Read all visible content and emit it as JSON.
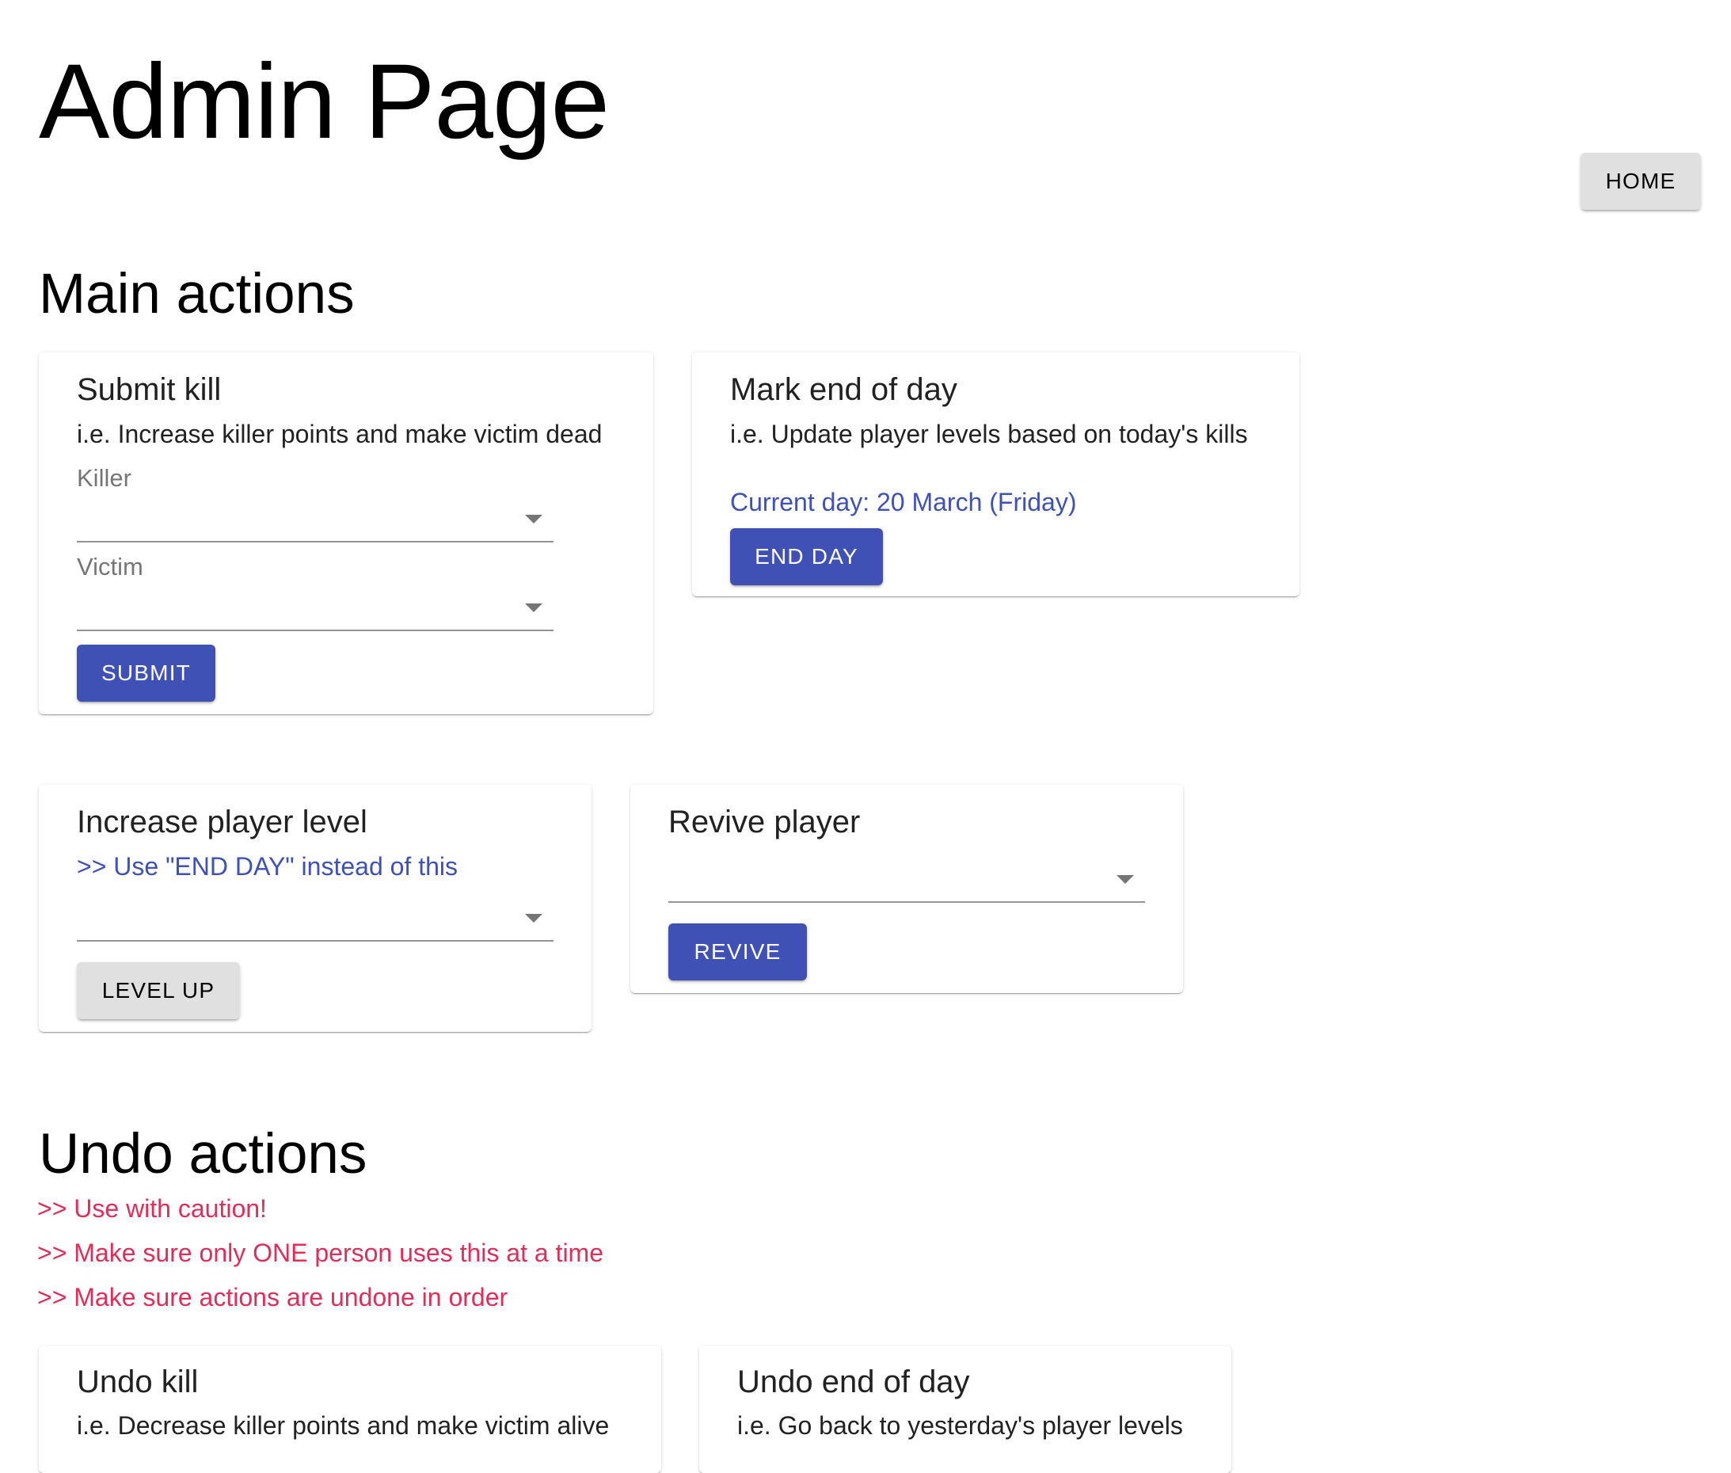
{
  "header": {
    "title": "Admin Page",
    "home_label": "HOME"
  },
  "main_actions": {
    "title": "Main actions",
    "submit_kill": {
      "title": "Submit kill",
      "description": "i.e. Increase killer points and make victim dead",
      "killer_label": "Killer",
      "victim_label": "Victim",
      "submit_label": "SUBMIT"
    },
    "end_of_day": {
      "title": "Mark end of day",
      "description": "i.e. Update player levels based on today's kills",
      "current_day": "Current day: 20 March (Friday)",
      "end_day_label": "END DAY"
    },
    "increase_level": {
      "title": "Increase player level",
      "note": ">> Use \"END DAY\" instead of this",
      "level_up_label": "LEVEL UP"
    },
    "revive": {
      "title": "Revive player",
      "revive_label": "REVIVE"
    }
  },
  "undo_actions": {
    "title": "Undo actions",
    "warnings": [
      ">> Use with caution!",
      ">> Make sure only ONE person uses this at a time",
      ">> Make sure actions are undone in order"
    ],
    "undo_kill": {
      "title": "Undo kill",
      "description": "i.e. Decrease killer points and make victim alive"
    },
    "undo_end_of_day": {
      "title": "Undo end of day",
      "description": "i.e. Go back to yesterday's player levels"
    }
  },
  "colors": {
    "primary": "#3F51B5",
    "warning": "#DC2F5A",
    "default_button": "#e0e0e0"
  },
  "icons": {
    "select_arrow": "arrow-drop-down-icon"
  }
}
